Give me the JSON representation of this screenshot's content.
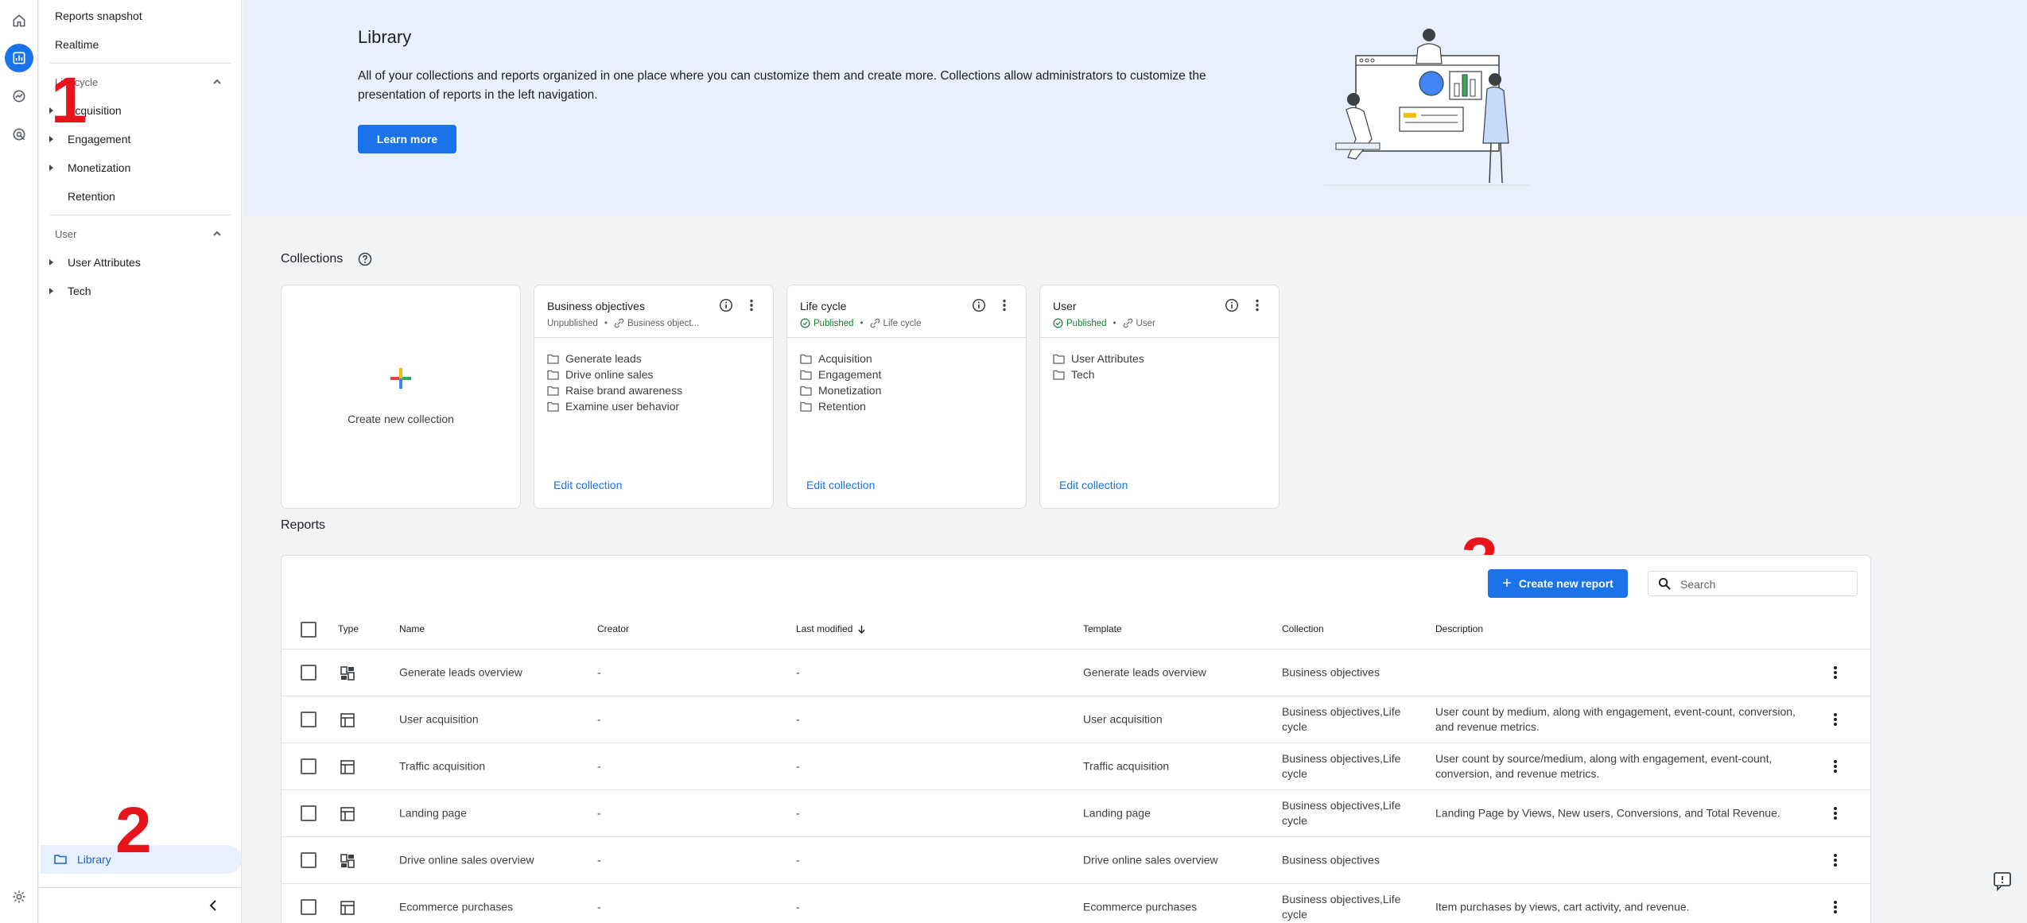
{
  "nav": {
    "top_items": [
      "Reports snapshot",
      "Realtime"
    ],
    "lifecycle_label": "Life cycle",
    "lifecycle_items": [
      "Acquisition",
      "Engagement",
      "Monetization",
      "Retention"
    ],
    "user_label": "User",
    "user_items": [
      "User Attributes",
      "Tech"
    ],
    "library_label": "Library"
  },
  "annotations": [
    "1",
    "2",
    "3"
  ],
  "banner": {
    "title": "Library",
    "text": "All of your collections and reports organized in one place where you can customize them and create more. Collections allow administrators to customize the presentation of reports in the left navigation.",
    "learn_more": "Learn more"
  },
  "collections": {
    "title": "Collections",
    "create_label": "Create new collection",
    "cards": [
      {
        "title": "Business objectives",
        "status": "Unpublished",
        "template": "Business object...",
        "items": [
          "Generate leads",
          "Drive online sales",
          "Raise brand awareness",
          "Examine user behavior"
        ],
        "edit": "Edit collection"
      },
      {
        "title": "Life cycle",
        "status": "Published",
        "template": "Life cycle",
        "items": [
          "Acquisition",
          "Engagement",
          "Monetization",
          "Retention"
        ],
        "edit": "Edit collection"
      },
      {
        "title": "User",
        "status": "Published",
        "template": "User",
        "items": [
          "User Attributes",
          "Tech"
        ],
        "edit": "Edit collection"
      }
    ]
  },
  "reports": {
    "title": "Reports",
    "create_label": "Create new report",
    "search_placeholder": "Search",
    "columns": {
      "type": "Type",
      "name": "Name",
      "creator": "Creator",
      "modified": "Last modified",
      "template": "Template",
      "collection": "Collection",
      "description": "Description"
    },
    "rows": [
      {
        "icon": "overview-icon",
        "name": "Generate leads overview",
        "creator": "-",
        "modified": "-",
        "template": "Generate leads overview",
        "collection": "Business objectives",
        "description": ""
      },
      {
        "icon": "table-icon",
        "name": "User acquisition",
        "creator": "-",
        "modified": "-",
        "template": "User acquisition",
        "collection": "Business objectives,Life cycle",
        "description": "User count by medium, along with engagement, event-count, conversion, and revenue metrics."
      },
      {
        "icon": "table-icon",
        "name": "Traffic acquisition",
        "creator": "-",
        "modified": "-",
        "template": "Traffic acquisition",
        "collection": "Business objectives,Life cycle",
        "description": "User count by source/medium, along with engagement, event-count, conversion, and revenue metrics."
      },
      {
        "icon": "table-icon",
        "name": "Landing page",
        "creator": "-",
        "modified": "-",
        "template": "Landing page",
        "collection": "Business objectives,Life cycle",
        "description": "Landing Page by Views, New users, Conversions, and Total Revenue."
      },
      {
        "icon": "overview-icon",
        "name": "Drive online sales overview",
        "creator": "-",
        "modified": "-",
        "template": "Drive online sales overview",
        "collection": "Business objectives",
        "description": ""
      },
      {
        "icon": "table-icon",
        "name": "Ecommerce purchases",
        "creator": "-",
        "modified": "-",
        "template": "Ecommerce purchases",
        "collection": "Business objectives,Life cycle",
        "description": "Item purchases by views, cart activity, and revenue."
      }
    ]
  },
  "colors": {
    "accent": "#1a73e8",
    "banner_bg": "#e8f0fe",
    "published": "#188038",
    "annotation": "#e8141b"
  }
}
